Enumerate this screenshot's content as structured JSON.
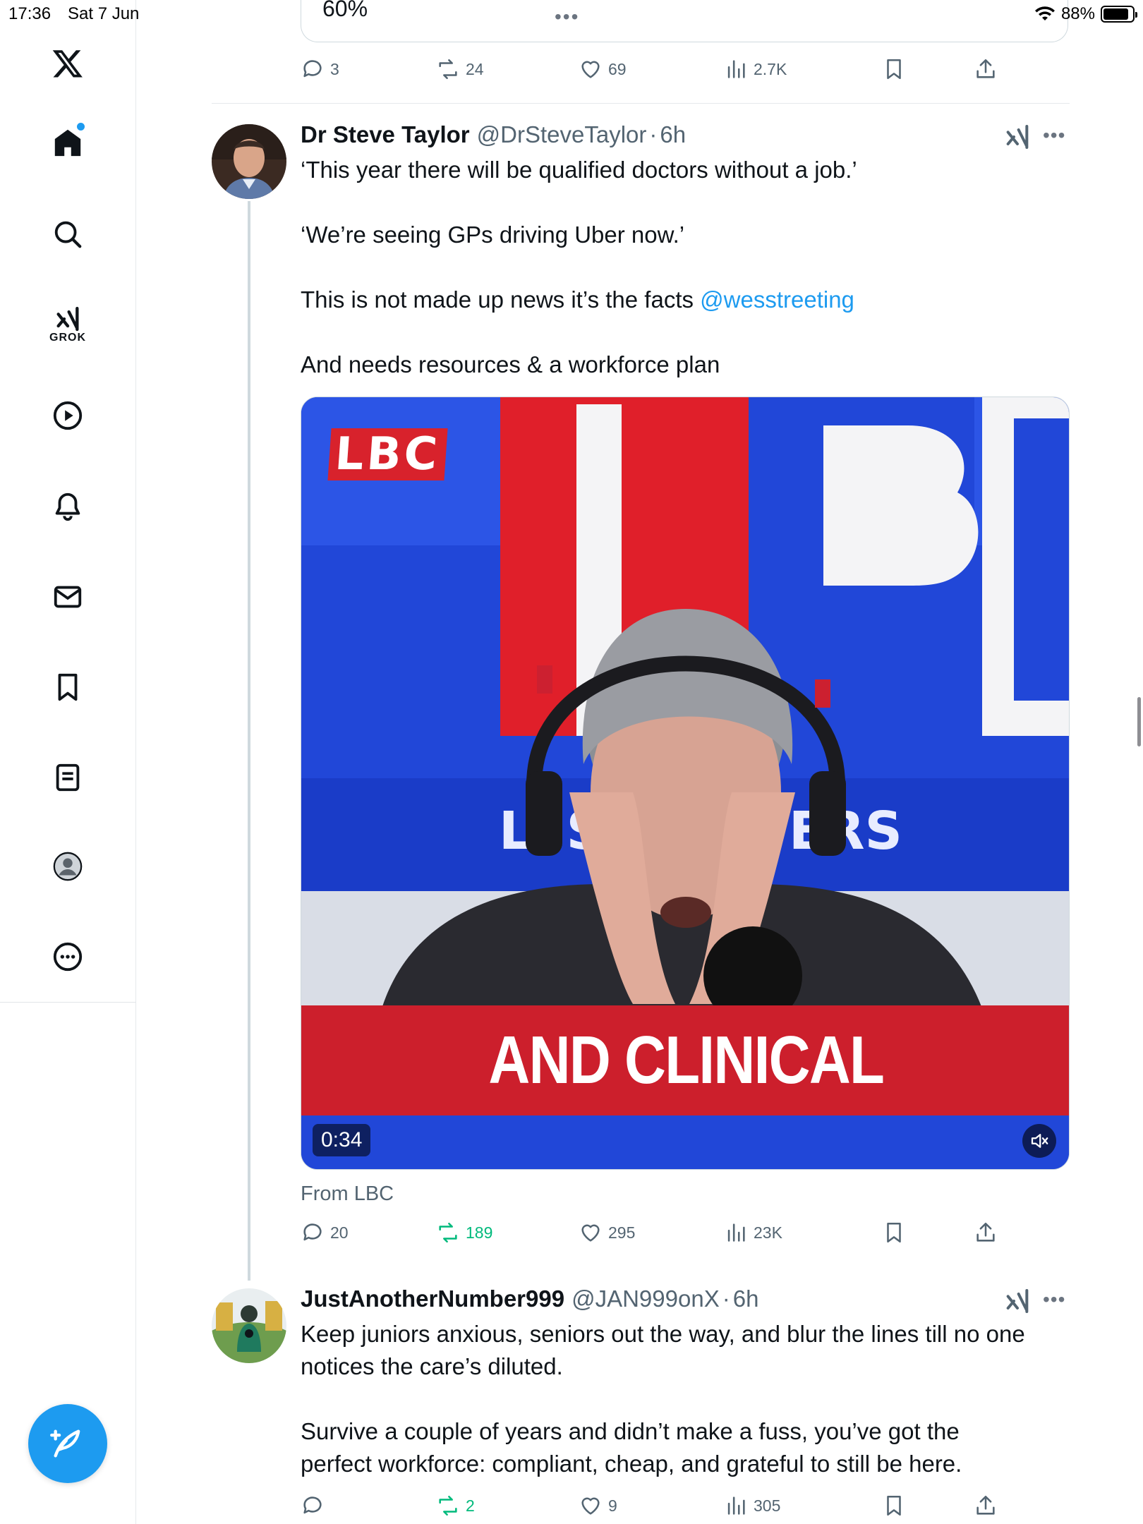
{
  "status_bar": {
    "time": "17:36",
    "date": "Sat 7 Jun",
    "battery": "88%",
    "battery_level": 0.88
  },
  "top_card": {
    "percent_text": "60%"
  },
  "top_actions": {
    "replies": "3",
    "reposts": "24",
    "likes": "69",
    "views": "2.7K"
  },
  "sidebar": {
    "items": [
      {
        "name": "home-icon"
      },
      {
        "name": "search-icon"
      },
      {
        "name": "grok-icon",
        "label": "GROK"
      },
      {
        "name": "video-icon"
      },
      {
        "name": "notifications-icon"
      },
      {
        "name": "messages-icon"
      },
      {
        "name": "bookmarks-icon"
      },
      {
        "name": "lists-icon"
      },
      {
        "name": "profile-icon"
      },
      {
        "name": "more-icon"
      }
    ]
  },
  "tweet1": {
    "name": "Dr Steve Taylor",
    "handle": "@DrSteveTaylor",
    "sep": "·",
    "ago": "6h",
    "line1": "‘This year there will be qualified doctors without a job.’",
    "line2": "‘We’re seeing GPs driving Uber now.’",
    "line3_prefix": "This is not made up news it’s the facts ",
    "line3_mention": "@wesstreeting",
    "line4": "And needs resources & a workforce plan",
    "media": {
      "logo": "LBC",
      "backdrop_text": "LBC",
      "ticker_text": "L      'S CONVERS",
      "caption": "AND CLINICAL",
      "duration": "0:34"
    },
    "source": "From LBC",
    "actions": {
      "replies": "20",
      "reposts": "189",
      "likes": "295",
      "views": "23K"
    }
  },
  "tweet2": {
    "name": "JustAnotherNumber999",
    "handle": "@JAN999onX",
    "sep": "·",
    "ago": "6h",
    "line1": "Keep juniors anxious, seniors out the way, and blur the lines till no one",
    "line2": "notices the care’s diluted.",
    "line3": "Survive a couple of years and didn’t make a fuss, you’ve got the",
    "line4": "perfect workforce: compliant, cheap, and grateful to still be here.",
    "actions": {
      "replies": "",
      "reposts": "2",
      "likes": "9",
      "views": "305"
    }
  },
  "colors": {
    "accent": "#1d9bf0",
    "repost_green": "#00ba7c",
    "lbc_red": "#cc1f2c",
    "lbc_blue": "#1f45d6"
  }
}
